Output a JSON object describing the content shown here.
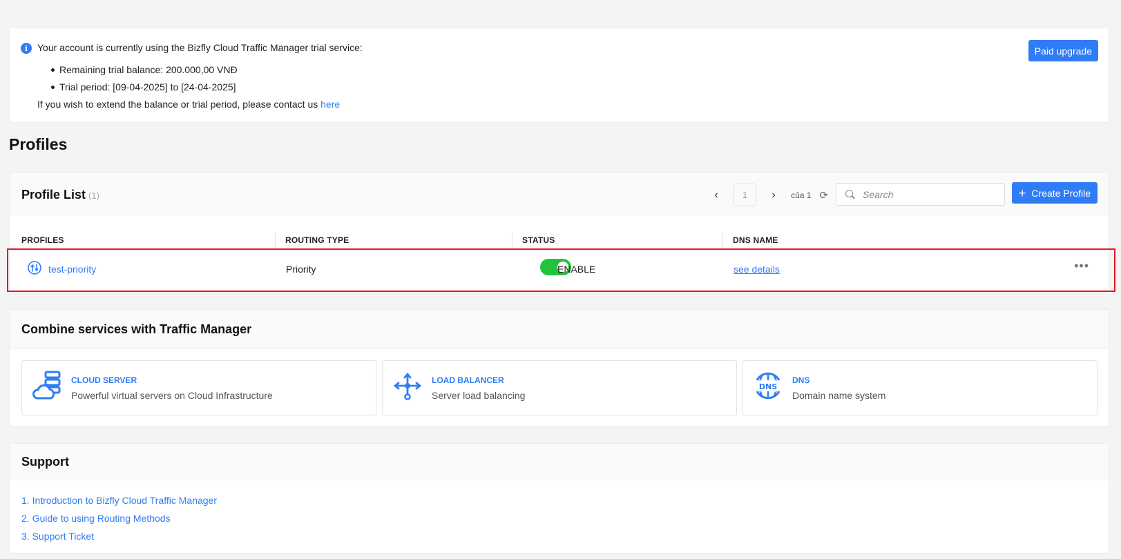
{
  "trial": {
    "intro": "Your account is currently using the Bizfly Cloud Traffic Manager trial service:",
    "balance": "Remaining trial balance: 200.000,00 VNĐ",
    "period": "Trial period: [09-04-2025] to [24-04-2025]",
    "extend_text": "If you wish to extend the balance or trial period, please contact us",
    "extend_link": "here",
    "upgrade_label": "Paid upgrade"
  },
  "page_title": "Profiles",
  "profile_list": {
    "title": "Profile List",
    "count": "(1)",
    "current_page": "1",
    "of_pages": "của 1",
    "search_placeholder": "Search",
    "create_label": "Create Profile",
    "columns": [
      "PROFILES",
      "ROUTING TYPE",
      "STATUS",
      "DNS NAME"
    ],
    "rows": [
      {
        "name": "test-priority",
        "routing_type": "Priority",
        "status": "ENABLE",
        "enabled": true,
        "dns_link": "see details"
      }
    ]
  },
  "combine": {
    "title": "Combine services with Traffic Manager",
    "services": [
      {
        "name": "CLOUD SERVER",
        "desc": "Powerful virtual servers on Cloud Infrastructure",
        "icon": "cloud-server-icon"
      },
      {
        "name": "LOAD BALANCER",
        "desc": "Server load balancing",
        "icon": "load-balancer-icon"
      },
      {
        "name": "DNS",
        "desc": "Domain name system",
        "icon": "dns-globe-icon"
      }
    ]
  },
  "support": {
    "title": "Support",
    "links": [
      "1. Introduction to Bizfly Cloud Traffic Manager",
      "2. Guide to using Routing Methods",
      "3. Support Ticket"
    ]
  },
  "colors": {
    "accent": "#2f7cf6",
    "toggle_on": "#20c43a",
    "highlight": "#e5141e"
  }
}
